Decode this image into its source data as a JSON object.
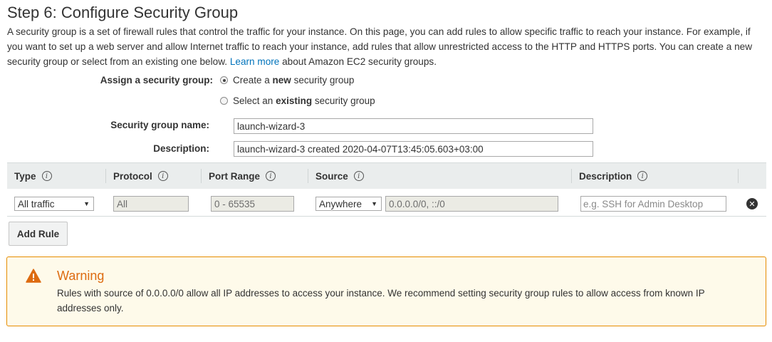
{
  "page": {
    "title": "Step 6: Configure Security Group",
    "intro": "A security group is a set of firewall rules that control the traffic for your instance. On this page, you can add rules to allow specific traffic to reach your instance. For example, if you want to set up a web server and allow Internet traffic to reach your instance, add rules that allow unrestricted access to the HTTP and HTTPS ports. You can create a new security group or select from an existing one below.",
    "learn_more": "Learn more",
    "intro_tail": "about Amazon EC2 security groups."
  },
  "form": {
    "assign_label": "Assign a security group:",
    "option_create_pre": "Create a",
    "option_create_bold": "new",
    "option_create_post": "security group",
    "option_select_pre": "Select an",
    "option_select_bold": "existing",
    "option_select_post": "security group",
    "selected_option": "create",
    "name_label": "Security group name:",
    "name_value": "launch-wizard-3",
    "description_label": "Description:",
    "description_value": "launch-wizard-3 created 2020-04-07T13:45:05.603+03:00"
  },
  "rules_table": {
    "columns": [
      "Type",
      "Protocol",
      "Port Range",
      "Source",
      "Description"
    ],
    "info_glyph": "i",
    "rows": [
      {
        "type": "All traffic",
        "protocol": "All",
        "port_range": "0 - 65535",
        "source_select": "Anywhere",
        "source_cidr": "0.0.0.0/0, ::/0",
        "description_placeholder": "e.g. SSH for Admin Desktop"
      }
    ],
    "add_rule_label": "Add Rule",
    "remove_icon": "remove-icon"
  },
  "warning": {
    "title": "Warning",
    "message": "Rules with source of 0.0.0.0/0 allow all IP addresses to access your instance. We recommend setting security group rules to allow access from known IP addresses only.",
    "icon": "warning-icon"
  },
  "colors": {
    "link": "#0073bb",
    "warning_accent": "#dd6b10",
    "warning_border": "#e68c00",
    "warning_bg": "#fefaea",
    "table_header_bg": "#eaeded"
  }
}
